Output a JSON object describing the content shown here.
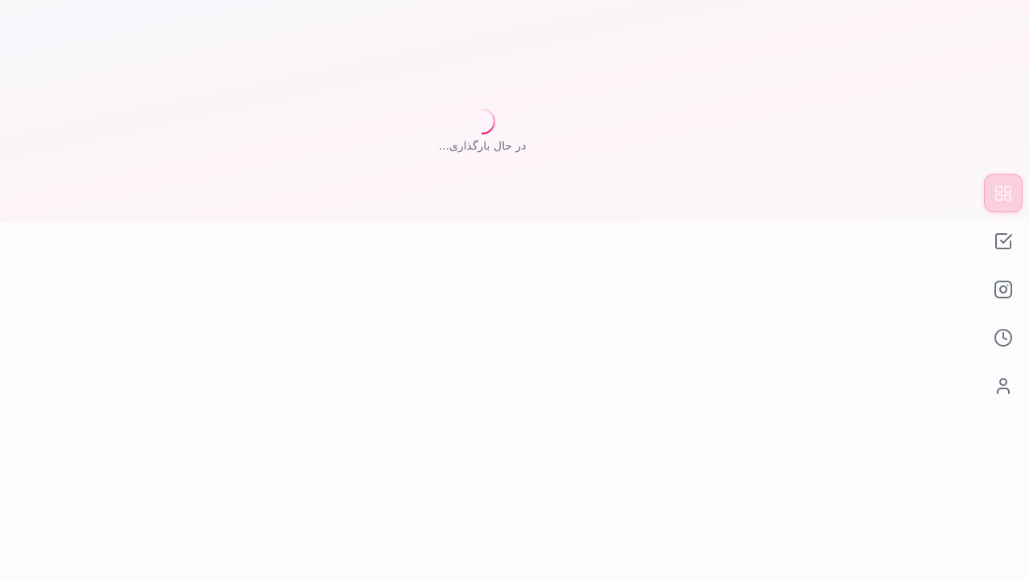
{
  "loading": {
    "text": "در حال بارگذاری..."
  },
  "colors": {
    "accent": "#ec4899",
    "active_bg": "#fccfde",
    "icon": "#6b7280",
    "text_muted": "#6b7280"
  },
  "nav": {
    "items": [
      {
        "icon": "dashboard-grid-icon",
        "active": true
      },
      {
        "icon": "checkbox-tasks-icon",
        "active": false
      },
      {
        "icon": "instagram-icon",
        "active": false
      },
      {
        "icon": "clock-history-icon",
        "active": false
      },
      {
        "icon": "user-profile-icon",
        "active": false
      }
    ]
  }
}
